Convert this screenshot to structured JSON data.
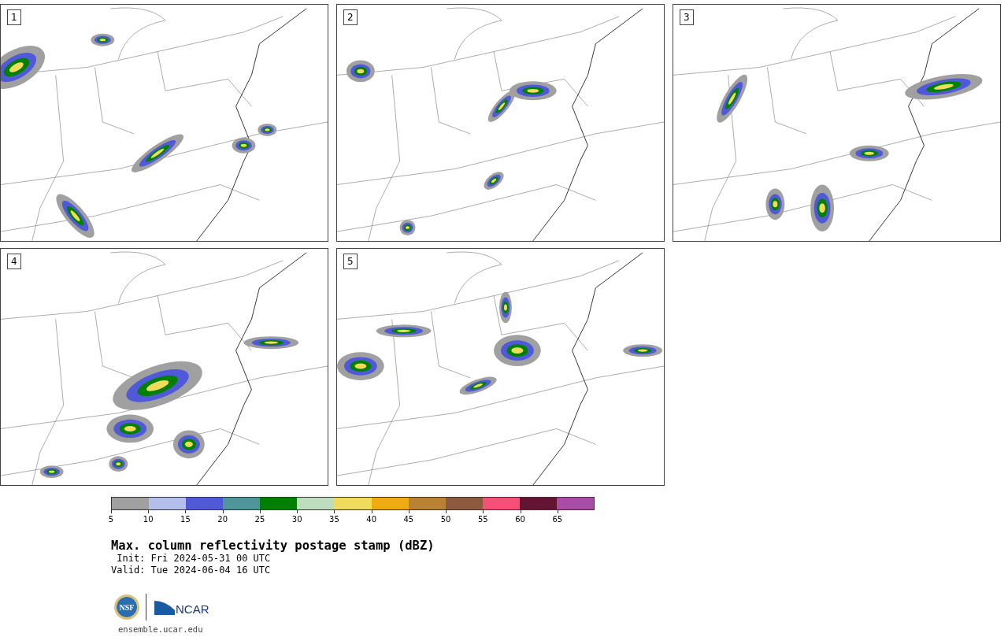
{
  "panels": [
    {
      "label": "1"
    },
    {
      "label": "2"
    },
    {
      "label": "3"
    },
    {
      "label": "4"
    },
    {
      "label": "5"
    }
  ],
  "colorbar": {
    "segments": [
      {
        "color": "#a0a0a0"
      },
      {
        "color": "#b4bfec"
      },
      {
        "color": "#505ad8"
      },
      {
        "color": "#4f969b"
      },
      {
        "color": "#008000"
      },
      {
        "color": "#bedcbe"
      },
      {
        "color": "#f0dc5a"
      },
      {
        "color": "#f0aa14"
      },
      {
        "color": "#b98232"
      },
      {
        "color": "#8c5a3c"
      },
      {
        "color": "#f55078"
      },
      {
        "color": "#641432"
      },
      {
        "color": "#aa4ba5"
      }
    ],
    "ticks": [
      "5",
      "10",
      "15",
      "20",
      "25",
      "30",
      "35",
      "40",
      "45",
      "50",
      "55",
      "60",
      "65"
    ]
  },
  "title": "Max. column reflectivity postage stamp (dBZ)",
  "init": " Init: Fri 2024-05-31 00 UTC",
  "valid": "Valid: Tue 2024-06-04 16 UTC",
  "logo": {
    "nsf": "NSF",
    "ncar": "NCAR"
  },
  "url": "ensemble.ucar.edu"
}
